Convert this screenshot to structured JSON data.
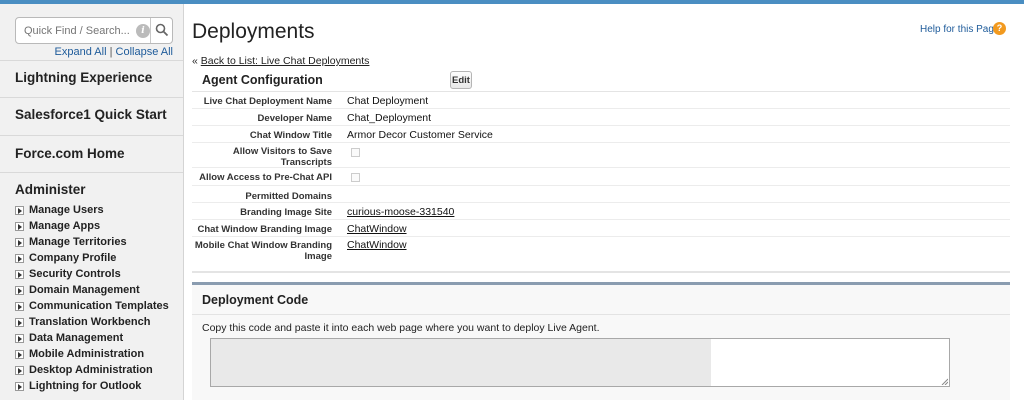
{
  "sidebar": {
    "search_placeholder": "Quick Find / Search...",
    "expand_all": "Expand All",
    "separator": "|",
    "collapse_all": "Collapse All",
    "sections": [
      "Lightning Experience",
      "Salesforce1 Quick Start",
      "Force.com Home",
      "Administer"
    ],
    "admin_items": [
      "Manage Users",
      "Manage Apps",
      "Manage Territories",
      "Company Profile",
      "Security Controls",
      "Domain Management",
      "Communication Templates",
      "Translation Workbench",
      "Data Management",
      "Mobile Administration",
      "Desktop Administration",
      "Lightning for Outlook"
    ]
  },
  "main": {
    "title": "Deployments",
    "help_label": "Help for this Page",
    "back_prefix": "«",
    "back_link": "Back to List: Live Chat Deployments",
    "agent_config": {
      "title": "Agent Configuration",
      "edit_label": "Edit",
      "rows": [
        {
          "label": "Live Chat Deployment Name",
          "value": "Chat Deployment"
        },
        {
          "label": "Developer Name",
          "value": "Chat_Deployment"
        },
        {
          "label": "Chat Window Title",
          "value": "Armor Decor Customer Service"
        },
        {
          "label": "Allow Visitors to Save Transcripts",
          "checked": false
        },
        {
          "label": "Allow Access to Pre-Chat API",
          "checked": false
        },
        {
          "label": "Permitted Domains",
          "value": ""
        },
        {
          "label": "Branding Image Site",
          "value": "curious-moose-331540"
        },
        {
          "label": "Chat Window Branding Image",
          "value": "ChatWindow"
        },
        {
          "label": "Mobile Chat Window Branding Image",
          "value": "ChatWindow"
        }
      ]
    },
    "deployment_code": {
      "title": "Deployment Code",
      "instructions": "Copy this code and paste it into each web page where you want to deploy Live Agent."
    }
  },
  "colors": {
    "topbar": "#4a8ec2",
    "link": "#1e5b9a",
    "help_icon": "#f29a1f",
    "code_panel_border": "#8a9cb0"
  },
  "icons": [
    "info-icon",
    "search-icon",
    "expand-triangle-icon",
    "help-icon",
    "resize-handle-icon"
  ]
}
